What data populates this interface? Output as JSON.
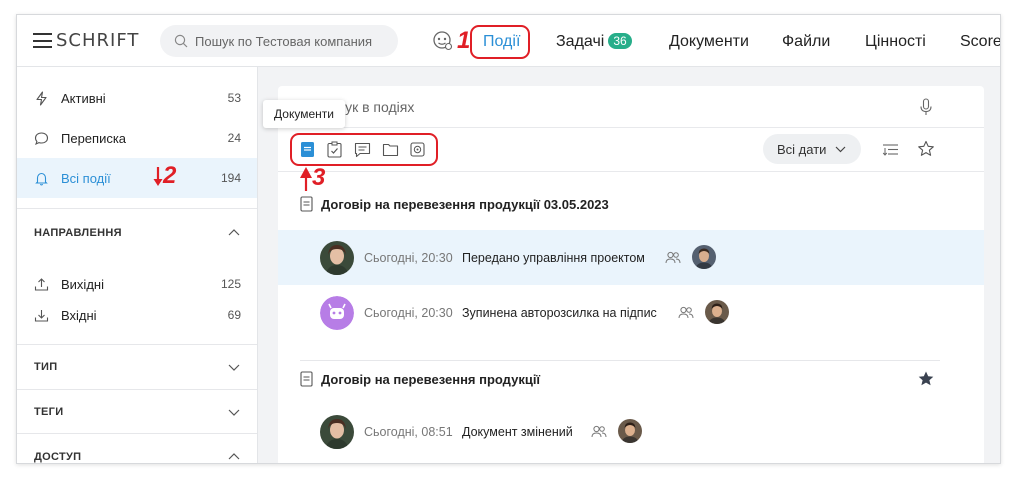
{
  "app": {
    "logo_text": "SCHRIFT",
    "search_placeholder": "Пошук по Тестовая компания"
  },
  "nav": {
    "items": [
      {
        "label": "Події",
        "active": true
      },
      {
        "label": "Задачі",
        "badge": "36"
      },
      {
        "label": "Документи"
      },
      {
        "label": "Файли"
      },
      {
        "label": "Цінності"
      },
      {
        "label": "Score"
      }
    ]
  },
  "sidebar": {
    "items": [
      {
        "label": "Активні",
        "count": "53",
        "icon": "lightning-icon"
      },
      {
        "label": "Переписка",
        "count": "24",
        "icon": "chat-bubble-icon"
      },
      {
        "label": "Всі події",
        "count": "194",
        "icon": "bell-icon",
        "active": true
      }
    ],
    "sections": {
      "direction": {
        "title": "НАПРАВЛЕННЯ",
        "items": [
          {
            "label": "Вихідні",
            "count": "125",
            "icon": "upload-icon"
          },
          {
            "label": "Вхідні",
            "count": "69",
            "icon": "download-icon"
          }
        ]
      },
      "type": {
        "title": "ТИП"
      },
      "tags": {
        "title": "ТЕГИ"
      },
      "access": {
        "title": "ДОСТУП"
      }
    }
  },
  "main": {
    "search_placeholder": "Пошук в подіях",
    "tooltip": "Документи",
    "dates_filter": "Всі дати",
    "filter_icons": [
      "document-icon",
      "task-checklist-icon",
      "message-icon",
      "folder-icon",
      "valuables-icon"
    ],
    "groups": [
      {
        "title": "Договір на перевезення продукції 03.05.2023",
        "events": [
          {
            "time": "Сьогодні, 20:30",
            "text": "Передано управління проектом",
            "highlight": true
          },
          {
            "time": "Сьогодні, 20:30",
            "text": "Зупинена авторозсилка на підпис",
            "highlight": false
          }
        ]
      },
      {
        "title": "Договір на перевезення продукції",
        "starred": true,
        "events": [
          {
            "time": "Сьогодні, 08:51",
            "text": "Документ змінений",
            "highlight": false
          }
        ]
      }
    ]
  },
  "annotations": {
    "labels": [
      "1",
      "2",
      "3"
    ],
    "color": "#e01f26"
  },
  "colors": {
    "accent": "#2b8fd6",
    "badge": "#27ae8a",
    "highlight_bg": "#eaf4fc",
    "bot_avatar": "#b77de6"
  }
}
